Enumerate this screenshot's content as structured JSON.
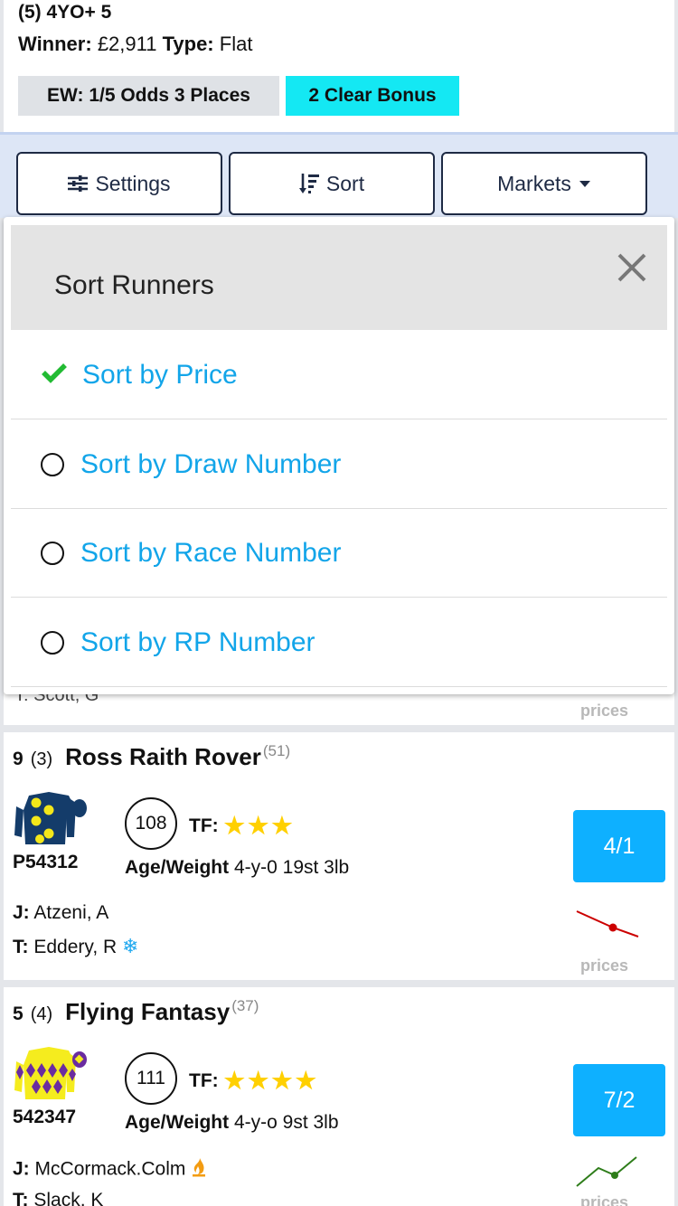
{
  "race": {
    "title": "(5) 4YO+ 5",
    "winner_label": "Winner:",
    "winner_value": "£2,911",
    "type_label": "Type:",
    "type_value": "Flat",
    "ew_badge": "EW: 1/5 Odds 3 Places",
    "bonus_badge": "2 Clear Bonus"
  },
  "toolbar": {
    "settings_label": "Settings",
    "sort_label": "Sort",
    "markets_label": "Markets"
  },
  "modal": {
    "title": "Sort Runners",
    "options": [
      {
        "label": "Sort by Price",
        "selected": true
      },
      {
        "label": "Sort by Draw Number",
        "selected": false
      },
      {
        "label": "Sort by Race Number",
        "selected": false
      },
      {
        "label": "Sort by RP Number",
        "selected": false
      }
    ]
  },
  "prev_card": {
    "partial_text": "T: Scott, G",
    "prices_label": "prices"
  },
  "runners": [
    {
      "number": "9",
      "draw": "(3)",
      "name": "Ross Raith Rover",
      "rating": "(51)",
      "code": "P54312",
      "rp_rating": "108",
      "tf_label": "TF:",
      "stars": "★★★",
      "age_weight_label": "Age/Weight",
      "age_weight": "4-y-0 19st 3lb",
      "jockey_label": "J:",
      "jockey": "Atzeni, A",
      "trainer_label": "T:",
      "trainer": "Eddery, R",
      "trainer_icon": "snowflake-icon",
      "odds": "4/1",
      "prices_label": "prices",
      "trend": "drifting",
      "trend_color": "#cc0000"
    },
    {
      "number": "5",
      "draw": "(4)",
      "name": "Flying Fantasy",
      "rating": "(37)",
      "code": "542347",
      "rp_rating": "111",
      "tf_label": "TF:",
      "stars": "★★★★",
      "age_weight_label": "Age/Weight",
      "age_weight": "4-y-o 9st 3lb",
      "jockey_label": "J:",
      "jockey": "McCormack.Colm",
      "jockey_icon": "flame-icon",
      "trainer_label": "T:",
      "trainer": "Slack, K",
      "odds": "7/2",
      "prices_label": "prices",
      "trend": "shortening",
      "trend_color": "#2e7d1a"
    }
  ],
  "colors": {
    "accent": "#12a5e9",
    "odds_button": "#0eb0ff",
    "bonus": "#14e8f3",
    "check": "#22bb33"
  }
}
